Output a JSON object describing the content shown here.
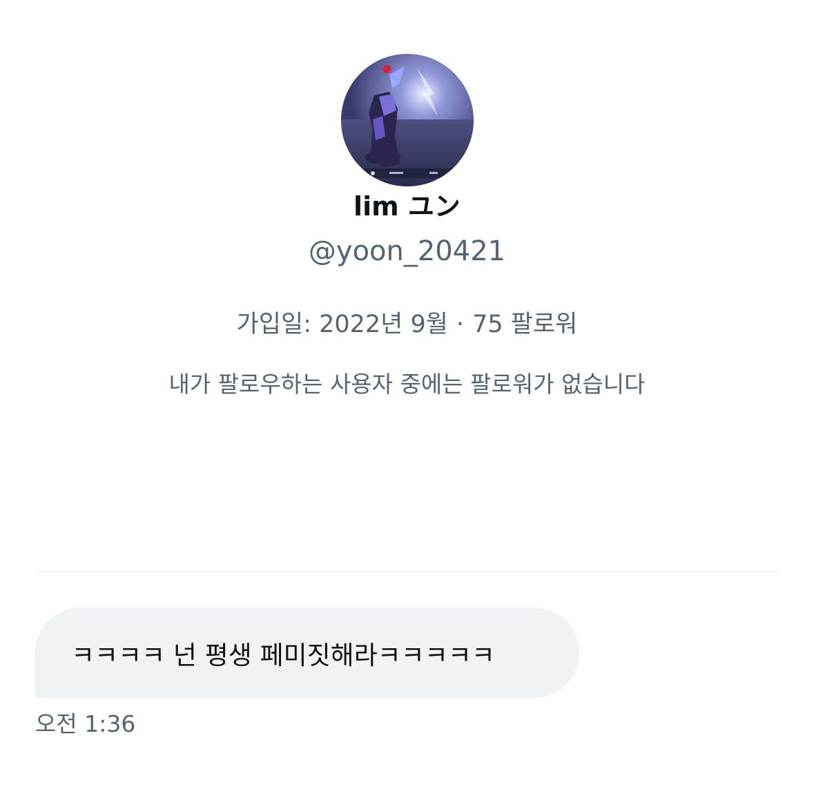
{
  "profile": {
    "avatar_icon": "profile-avatar-image",
    "display_name": "lim ユン",
    "handle": "@yoon_20421",
    "joined": "가입일: 2022년 9월",
    "separator": "·",
    "followers": "75 팔로워",
    "mutual_note": "내가 팔로우하는 사용자 중에는 팔로워가 없습니다"
  },
  "conversation": {
    "messages": [
      {
        "text": "ㅋㅋㅋㅋ 넌 평생 페미짓해라ㅋㅋㅋㅋㅋ",
        "time": "오전 1:36"
      }
    ]
  },
  "colors": {
    "text_primary": "#0f1419",
    "text_secondary": "#536471",
    "bubble_background": "#eff3f4",
    "divider": "#eff3f4"
  }
}
